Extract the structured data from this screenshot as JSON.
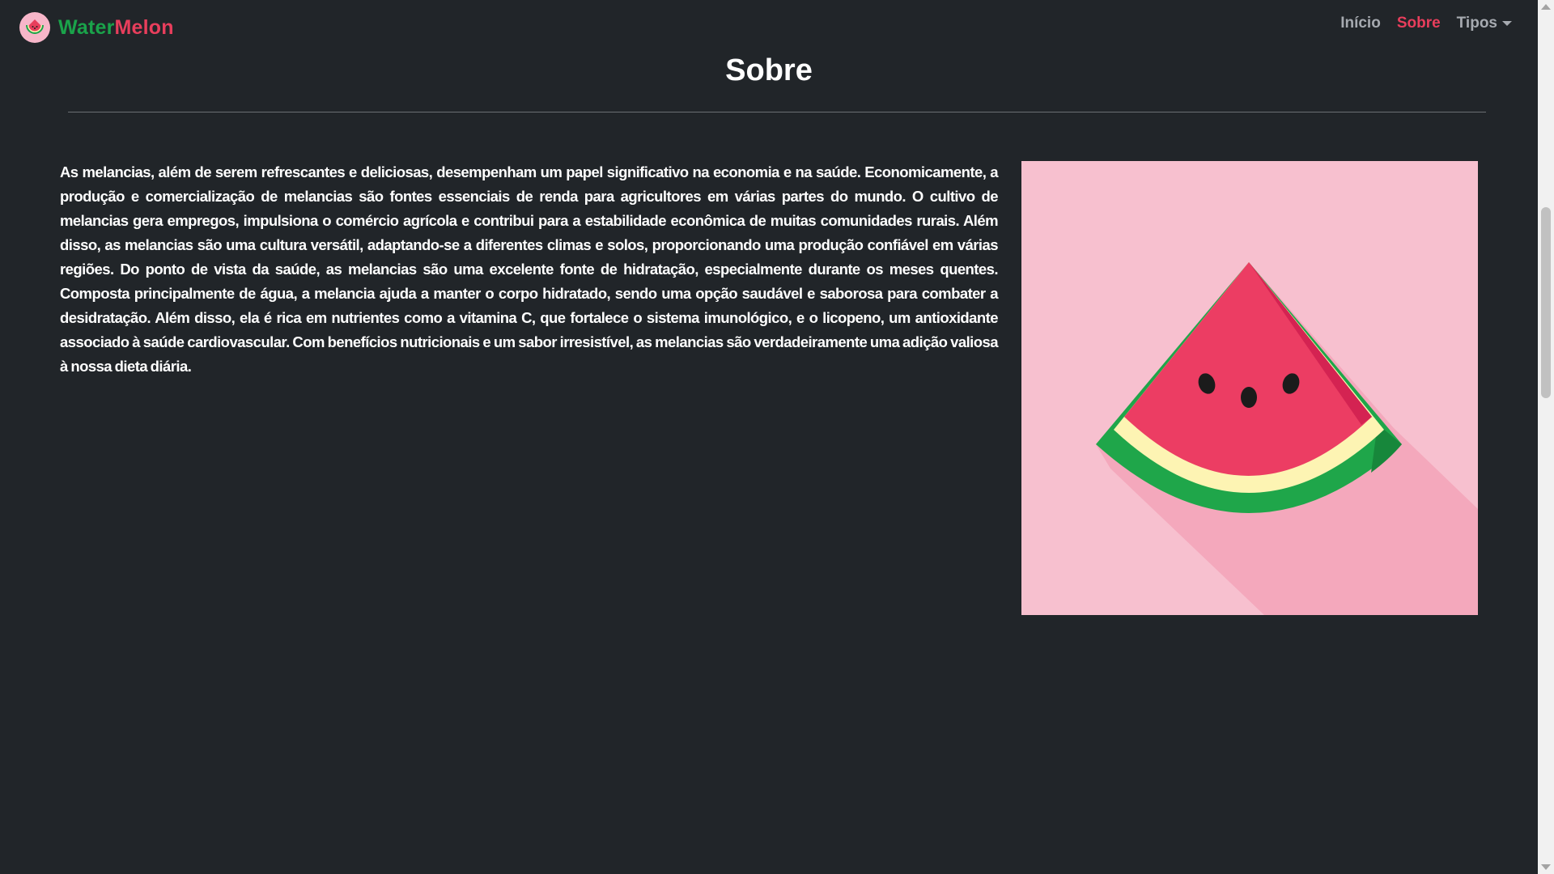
{
  "navbar": {
    "brand_water": "Water",
    "brand_melon": "Melon",
    "links": [
      {
        "label": "Início"
      },
      {
        "label": "Sobre"
      },
      {
        "label": "Tipos"
      }
    ]
  },
  "main": {
    "title": "Sobre",
    "paragraph": "As melancias, além de serem refrescantes e deliciosas, desempenham um papel significativo na economia e na saúde. Economicamente, a produção e comercialização de melancias são fontes essenciais de renda para agricultores em várias partes do mundo. O cultivo de melancias gera empregos, impulsiona o comércio agrícola e contribui para a estabilidade econômica de muitas comunidades rurais. Além disso, as melancias são uma cultura versátil, adaptando-se a diferentes climas e solos, proporcionando uma produção confiável em várias regiões. Do ponto de vista da saúde, as melancias são uma excelente fonte de hidratação, especialmente durante os meses quentes. Composta principalmente de água, a melancia ajuda a manter o corpo hidratado, sendo uma opção saudável e saborosa para combater a desidratação. Além disso, ela é rica em nutrientes como a vitamina C, que fortalece o sistema imunológico, e o licopeno, um antioxidante associado à saúde cardiovascular. Com benefícios nutricionais e um sabor irresistível, as melancias são verdadeiramente uma adição valiosa à nossa dieta diária."
  },
  "icons": {
    "brand_logo": "watermelon-logo-icon",
    "image": "watermelon-slice-illustration",
    "dropdown": "caret-down-icon"
  },
  "colors": {
    "background": "#212529",
    "brand_green": "#1aa34a",
    "brand_red": "#e83e5c",
    "nav_inactive": "#a6aab0",
    "image_background": "#f7c0cf"
  }
}
